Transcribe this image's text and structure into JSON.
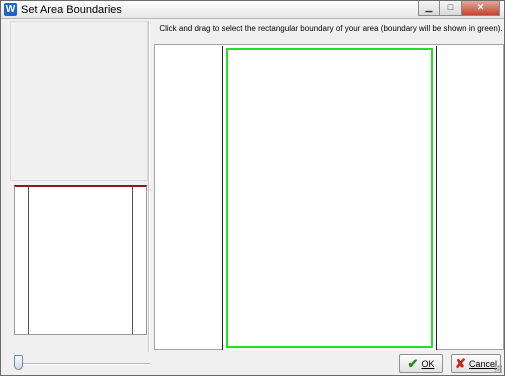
{
  "window": {
    "title": "Set Area Boundaries",
    "app_icon_letter": "W",
    "minimize_glyph": "▁",
    "maximize_glyph": "□",
    "close_glyph": "✕"
  },
  "main": {
    "instruction": "Click and drag to select the rectangular boundary of your area (boundary will be shown in green)."
  },
  "buttons": {
    "ok_label": "OK",
    "cancel_label": "Cancel"
  },
  "colors": {
    "boundary": "#24e024",
    "preview_top_edge": "#8b1a1a"
  },
  "icons": {
    "ok": "check-icon",
    "cancel": "x-icon"
  }
}
